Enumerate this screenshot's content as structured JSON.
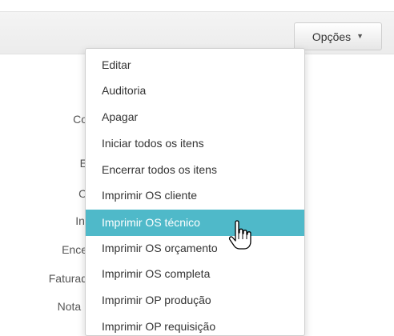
{
  "toolbar": {
    "options_label": "Opções",
    "options_caret": "▼"
  },
  "form_labels": [
    "Co",
    "E",
    "O",
    "Ini",
    "Ence",
    "Faturad",
    "Nota I"
  ],
  "menu": {
    "items": [
      "Editar",
      "Auditoria",
      "Apagar",
      "Iniciar todos os itens",
      "Encerrar todos os itens",
      "Imprimir OS cliente",
      "Imprimir OS técnico",
      "Imprimir OS orçamento",
      "Imprimir OS completa",
      "Imprimir OP produção",
      "Imprimir OP requisição"
    ],
    "active_index": 6,
    "active_color": "#4fb9c9"
  },
  "cursor": {
    "icon": "hand-pointer-icon"
  }
}
